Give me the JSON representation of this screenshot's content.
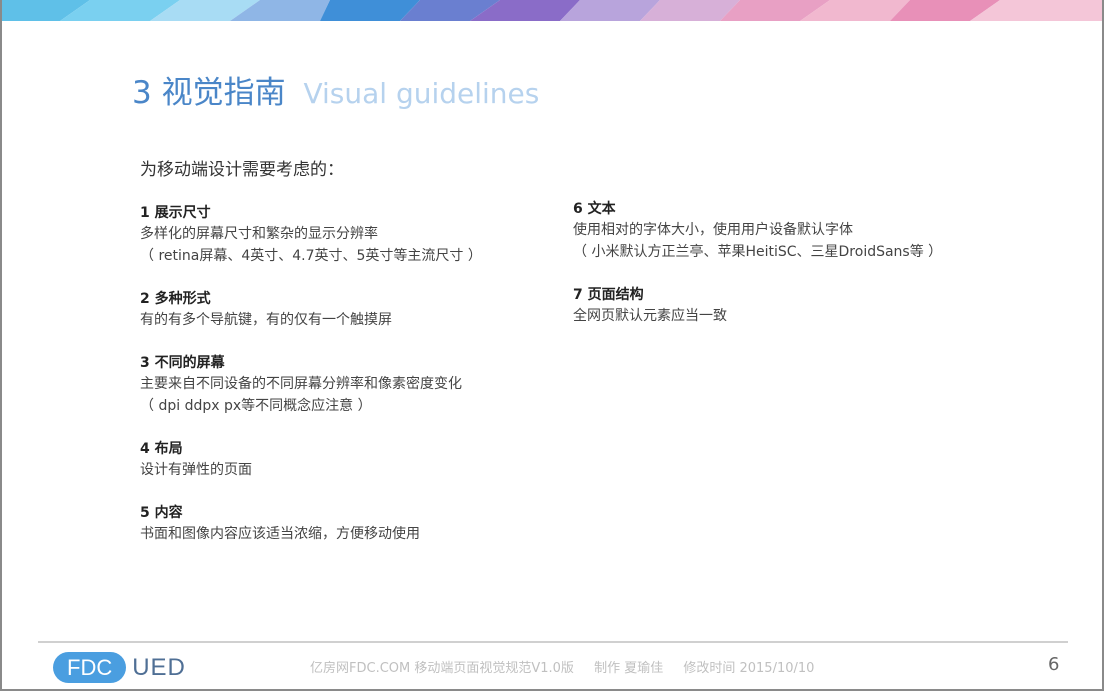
{
  "slide": {
    "title_number": "3",
    "title_cn": "视觉指南",
    "title_en": "Visual guidelines",
    "intro": "为移动端设计需要考虑的：",
    "left_sections": [
      {
        "title": "1 展示尺寸",
        "lines": [
          "多样化的屏幕尺寸和繁杂的显示分辨率",
          "（ retina屏幕、4英寸、4.7英寸、5英寸等主流尺寸 ）"
        ]
      },
      {
        "title": "2 多种形式",
        "lines": [
          "有的有多个导航键，有的仅有一个触摸屏"
        ]
      },
      {
        "title": "3 不同的屏幕",
        "lines": [
          "主要来自不同设备的不同屏幕分辨率和像素密度变化",
          "（ dpi ddpx  px等不同概念应注意 ）"
        ]
      },
      {
        "title": "4 布局",
        "lines": [
          "设计有弹性的页面"
        ]
      },
      {
        "title": "5 内容",
        "lines": [
          "书面和图像内容应该适当浓缩，方便移动使用"
        ]
      }
    ],
    "right_sections": [
      {
        "title": "6 文本",
        "lines": [
          "使用相对的字体大小，使用用户设备默认字体",
          "（ 小米默认方正兰亭、苹果HeitiSC、三星DroidSans等 ）"
        ]
      },
      {
        "title": "7 页面结构",
        "lines": [
          "全网页默认元素应当一致"
        ]
      }
    ]
  },
  "footer": {
    "logo_left": "FDC",
    "logo_right": "UED",
    "doc_name": "亿房网FDC.COM 移动端页面视觉规范V1.0版",
    "author": "制作 夏瑜佳",
    "modified": "修改时间  2015/10/10",
    "page_number": "6"
  },
  "colors": {
    "title_blue": "#4a86c8",
    "title_light_blue": "#b6d2ee",
    "logo_blue": "#4a9ee0"
  }
}
